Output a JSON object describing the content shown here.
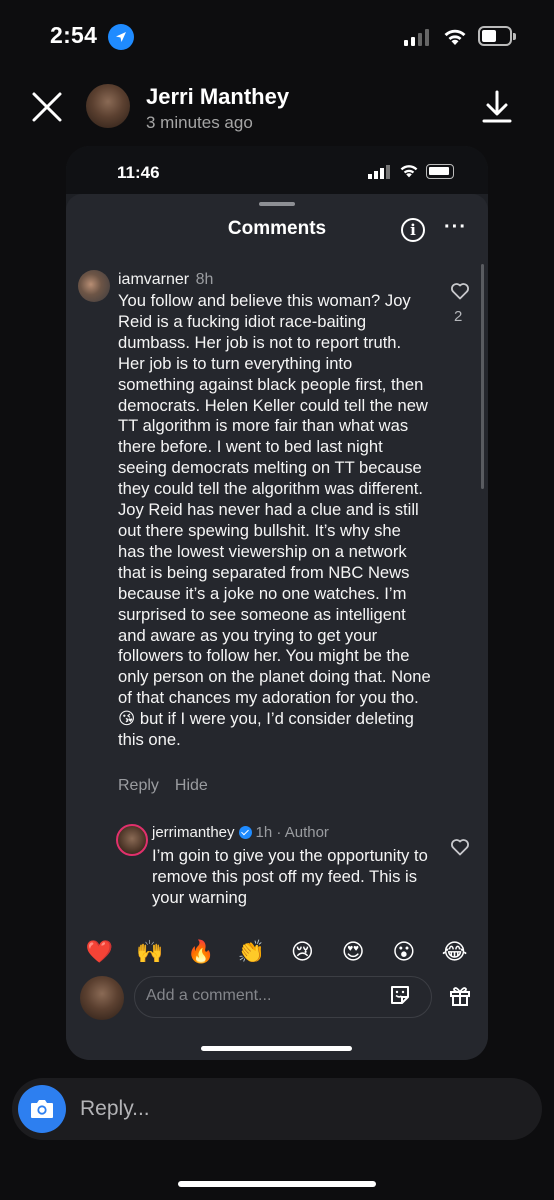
{
  "status_bar": {
    "time": "2:54"
  },
  "story_header": {
    "name": "Jerri Manthey",
    "time": "3 minutes ago"
  },
  "inner_screenshot": {
    "status_time": "11:46",
    "sheet": {
      "title": "Comments",
      "info_icon": "i",
      "more_icon": "···"
    },
    "comments": [
      {
        "username": "iamvarner",
        "time": "8h",
        "likes": "2",
        "text": "You follow and believe this woman? Joy Reid is a fucking idiot race-baiting dumbass. Her job is not to report truth. Her job is to turn everything into something against black people first, then democrats. Helen Keller could tell the new TT algorithm is more fair than what was there before. I went to bed last night seeing democrats melting on TT because they could tell the algorithm was different. Joy Reid has never had a clue and is still out there spewing bullshit. It’s why she has the lowest viewership on a network that is being separated from NBC News because it’s a joke no one watches. I’m surprised to see someone as intelligent and aware as you trying to get your followers to follow her. You might be the only person on the planet doing that. None of that chances my adoration for you tho. 😘 but if I were you, I’d consider deleting this one.",
        "actions": {
          "reply": "Reply",
          "hide": "Hide"
        }
      },
      {
        "username": "jerrimanthey",
        "meta": "1h · Author",
        "text": "I’m goin to give you the opportunity to remove this post off my feed. This is your warning"
      }
    ],
    "reactions": [
      "❤️",
      "🙌",
      "🔥",
      "👏",
      "😢",
      "😍",
      "😮",
      "😂"
    ],
    "comment_input": {
      "placeholder": "Add a comment..."
    }
  },
  "reply_bar": {
    "placeholder": "Reply..."
  },
  "icons": {
    "location": "location-arrow-icon",
    "close": "close-icon",
    "download": "download-icon",
    "heart": "heart-icon",
    "camera": "camera-icon",
    "sticker": "sticker-icon",
    "gift": "gift-icon"
  }
}
